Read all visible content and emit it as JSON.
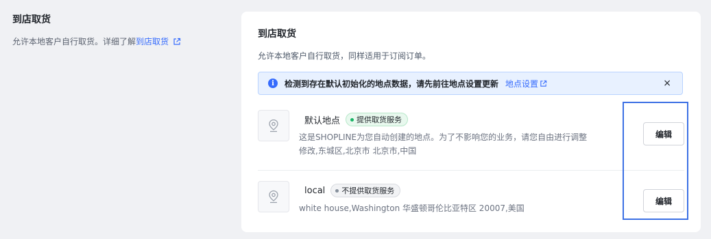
{
  "section": {
    "title": "到店取货",
    "description": "允许本地客户自行取货。详细了解",
    "link_label": "到店取货"
  },
  "card": {
    "title": "到店取货",
    "description": "允许本地客户自行取货，同样适用于订阅订单。"
  },
  "alert": {
    "message": "检测到存在默认初始化的地点数据，请先前往地点设置更新",
    "link_label": "地点设置",
    "close_icon": "×"
  },
  "locations": [
    {
      "name": "默认地点",
      "badge": "提供取货服务",
      "badge_status": "active",
      "description_line1": "这是SHOPLINE为您自动创建的地点。为了不影响您的业务，请您自由进行调整",
      "description_line2": "修改,东城区,北京市 北京市,中国",
      "edit_label": "编辑"
    },
    {
      "name": "local",
      "badge": "不提供取货服务",
      "badge_status": "inactive",
      "description_line1": "white house,Washington 华盛顿哥伦比亚特区 20007,美国",
      "edit_label": "编辑"
    }
  ],
  "colors": {
    "link": "#356bfd",
    "highlight": "#3b6fe4",
    "badge_green": "#16b364"
  },
  "icons": [
    "external-link-icon",
    "info-icon",
    "close-icon",
    "location-pin-icon"
  ]
}
